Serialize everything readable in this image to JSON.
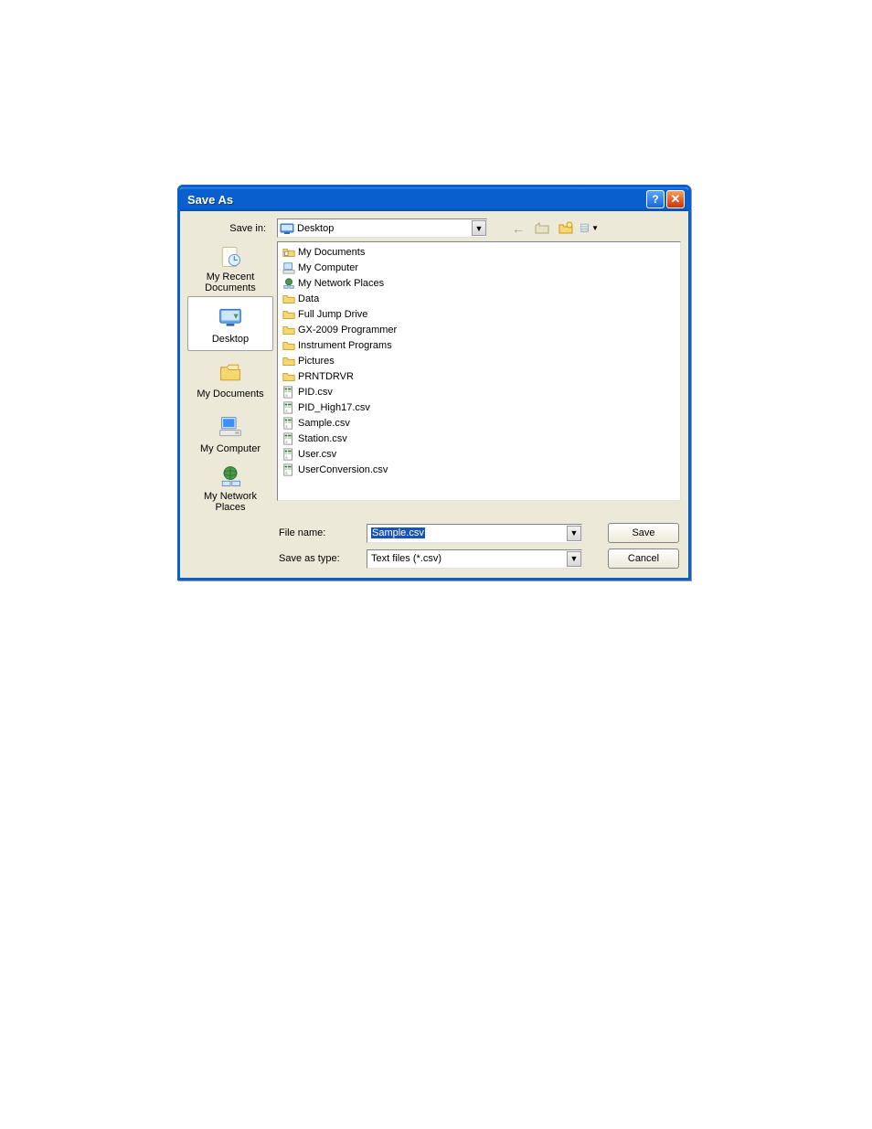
{
  "dialog": {
    "title": "Save As",
    "savein_label": "Save in:",
    "savein_value": "Desktop",
    "filename_label": "File name:",
    "filename_value": "Sample.csv",
    "filetype_label": "Save as type:",
    "filetype_value": "Text files (*.csv)",
    "save_btn": "Save",
    "cancel_btn": "Cancel"
  },
  "places": [
    {
      "label": "My Recent Documents"
    },
    {
      "label": "Desktop"
    },
    {
      "label": "My Documents"
    },
    {
      "label": "My Computer"
    },
    {
      "label": "My Network Places"
    }
  ],
  "files": [
    {
      "name": "My Documents",
      "type": "sysfolder"
    },
    {
      "name": "My Computer",
      "type": "syscomp"
    },
    {
      "name": "My Network Places",
      "type": "sysnet"
    },
    {
      "name": "Data",
      "type": "folder"
    },
    {
      "name": "Full Jump Drive",
      "type": "folder"
    },
    {
      "name": "GX-2009 Programmer",
      "type": "folder"
    },
    {
      "name": "Instrument Programs",
      "type": "folder"
    },
    {
      "name": "Pictures",
      "type": "folder"
    },
    {
      "name": "PRNTDRVR",
      "type": "folder"
    },
    {
      "name": "PID.csv",
      "type": "csv"
    },
    {
      "name": "PID_High17.csv",
      "type": "csv"
    },
    {
      "name": "Sample.csv",
      "type": "csv"
    },
    {
      "name": "Station.csv",
      "type": "csv"
    },
    {
      "name": "User.csv",
      "type": "csv"
    },
    {
      "name": "UserConversion.csv",
      "type": "csv"
    }
  ]
}
